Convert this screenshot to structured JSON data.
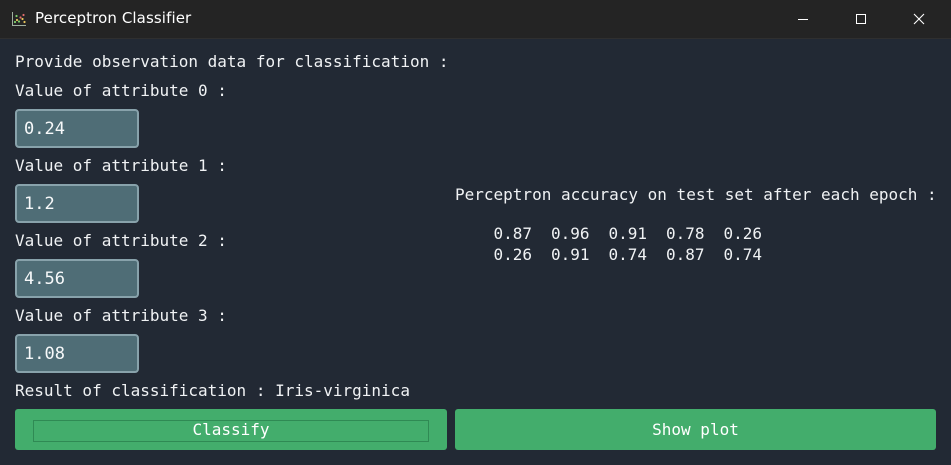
{
  "window": {
    "title": "Perceptron Classifier",
    "icon": "scatter-plot-icon",
    "controls": [
      "minimize-icon",
      "maximize-icon",
      "close-icon"
    ]
  },
  "form": {
    "prompt": "Provide observation data for classification :",
    "attributes": [
      {
        "label": "Value of attribute 0 :",
        "value": "0.24"
      },
      {
        "label": "Value of attribute 1 :",
        "value": "1.2"
      },
      {
        "label": "Value of attribute 2 :",
        "value": "4.56"
      },
      {
        "label": "Value of attribute 3 :",
        "value": "1.08"
      }
    ],
    "result": "Result of classification : Iris-virginica"
  },
  "accuracy": {
    "heading": "Perceptron accuracy on test set after each epoch :",
    "rows": [
      [
        "0.87",
        "0.96",
        "0.91",
        "0.78",
        "0.26"
      ],
      [
        "0.26",
        "0.91",
        "0.74",
        "0.87",
        "0.74"
      ]
    ]
  },
  "buttons": {
    "classify": "Classify",
    "show_plot": "Show plot"
  },
  "colors": {
    "background": "#222934",
    "titlebar": "#242424",
    "field_fill": "#4f6d76",
    "field_border": "#88a2ab",
    "button": "#43ad6c",
    "text": "#f0f2f4"
  }
}
